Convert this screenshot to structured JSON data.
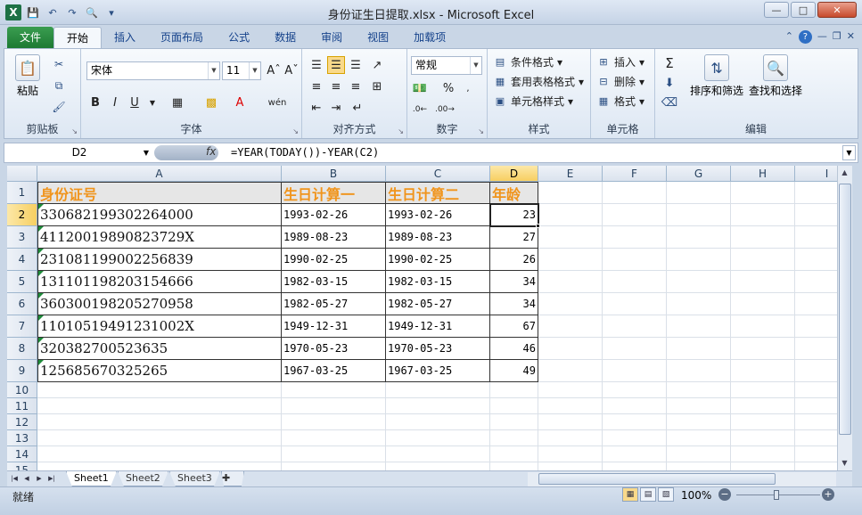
{
  "window": {
    "title": "身份证生日提取.xlsx - Microsoft Excel",
    "qat_icons": [
      "excel-logo-icon",
      "save-icon",
      "undo-icon",
      "redo-icon",
      "print-preview-icon",
      "customize-qat-icon"
    ]
  },
  "tabs": [
    "文件",
    "开始",
    "插入",
    "页面布局",
    "公式",
    "数据",
    "审阅",
    "视图",
    "加载项"
  ],
  "active_tab": "开始",
  "ribbon": {
    "clipboard": {
      "caption": "剪贴板",
      "paste": "粘贴"
    },
    "font": {
      "caption": "字体",
      "name": "宋体",
      "size": "11",
      "bold": "B",
      "italic": "I",
      "underline": "U",
      "phonetic": "wén"
    },
    "alignment": {
      "caption": "对齐方式"
    },
    "number": {
      "caption": "数字",
      "format": "常规",
      "percent": "%"
    },
    "styles": {
      "caption": "样式",
      "conditional": "条件格式",
      "table": "套用表格格式",
      "cell_styles": "单元格样式"
    },
    "cells": {
      "caption": "单元格",
      "insert": "插入",
      "delete": "删除",
      "format": "格式"
    },
    "editing": {
      "caption": "编辑",
      "sum": "Σ",
      "sort_filter": "排序和筛选",
      "find_select": "查找和选择"
    }
  },
  "formula_bar": {
    "name_box": "D2",
    "fx": "fx",
    "formula": "=YEAR(TODAY())-YEAR(C2)"
  },
  "sheet": {
    "columns": [
      "A",
      "B",
      "C",
      "D",
      "E",
      "F",
      "G",
      "H",
      "I"
    ],
    "selected_column": "D",
    "selected_row": "2",
    "row_numbers": [
      "1",
      "2",
      "3",
      "4",
      "5",
      "6",
      "7",
      "8",
      "9",
      "10",
      "11",
      "12",
      "13",
      "14",
      "15"
    ],
    "header": [
      "身份证号",
      "生日计算一",
      "生日计算二",
      "年龄"
    ],
    "rows": [
      [
        "330682199302264000",
        "1993-02-26",
        "1993-02-26",
        "23"
      ],
      [
        "41120019890823729X",
        "1989-08-23",
        "1989-08-23",
        "27"
      ],
      [
        "231081199002256839",
        "1990-02-25",
        "1990-02-25",
        "26"
      ],
      [
        "131101198203154666",
        "1982-03-15",
        "1982-03-15",
        "34"
      ],
      [
        "360300198205270958",
        "1982-05-27",
        "1982-05-27",
        "34"
      ],
      [
        "11010519491231002X",
        "1949-12-31",
        "1949-12-31",
        "67"
      ],
      [
        "320382700523635",
        "1970-05-23",
        "1970-05-23",
        "46"
      ],
      [
        "125685670325265",
        "1967-03-25",
        "1967-03-25",
        "49"
      ]
    ],
    "active_cell": "D2"
  },
  "sheet_tabs": [
    "Sheet1",
    "Sheet2",
    "Sheet3"
  ],
  "active_sheet": "Sheet1",
  "status": {
    "ready": "就绪",
    "zoom": "100%"
  }
}
